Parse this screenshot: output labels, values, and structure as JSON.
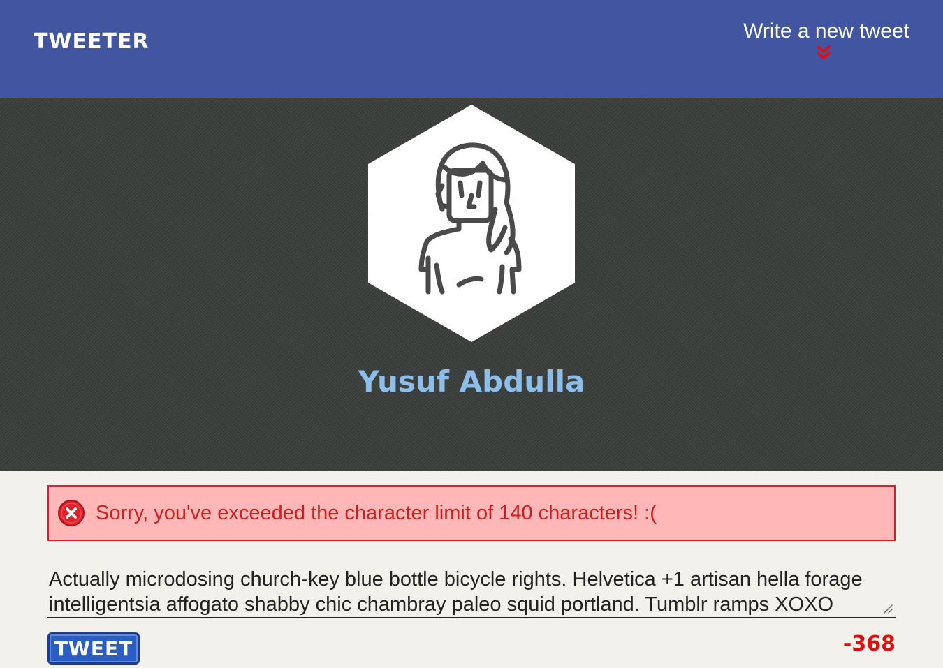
{
  "navbar": {
    "logo": "TWEETER",
    "compose_label": "Write a new tweet",
    "compose_icon": "double-chevron-down-icon",
    "background_color": "#4255a0",
    "accent_color": "#e40c0c"
  },
  "profile": {
    "avatar_icon": "user-avatar-icon",
    "name": "Yusuf Abdulla",
    "name_color": "#8dbde9"
  },
  "error": {
    "icon": "error-x-circle-icon",
    "message": "Sorry, you've exceeded the character limit of 140 characters! :(",
    "background_color": "#ffb7b7",
    "border_color": "#d2232d"
  },
  "composer": {
    "value": "Actually microdosing church-key blue bottle bicycle rights. Helvetica +1 artisan hella forage intelligentsia affogato shabby chic chambray paleo squid portland. Tumblr ramps XOXO",
    "submit_label": "TWEET",
    "char_counter": "-368"
  }
}
